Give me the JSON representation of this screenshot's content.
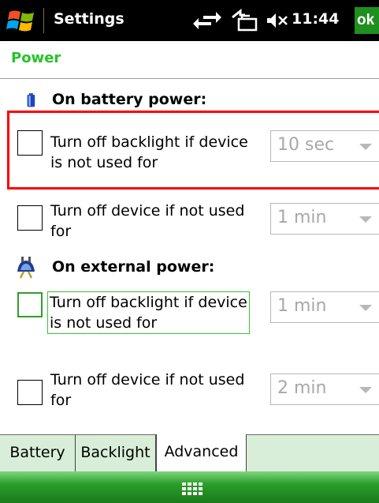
{
  "window": {
    "title": "Settings",
    "clock": "11:44",
    "ok_label": "ok"
  },
  "page": {
    "heading": "Power"
  },
  "battery_group": {
    "label": "On battery power:",
    "backlight": {
      "label_line1": "Turn off backlight if device",
      "label_line2": "is not used for",
      "checked": false,
      "value": "10 sec"
    },
    "device": {
      "label_line1": "Turn off device if not used",
      "label_line2": "for",
      "checked": false,
      "value": "1 min"
    }
  },
  "external_group": {
    "label": "On external power:",
    "backlight": {
      "label_line1": "Turn off backlight if device",
      "label_line2": "is not used for",
      "checked": false,
      "value": "1 min"
    },
    "device": {
      "label_line1": "Turn off device if not used",
      "label_line2": "for",
      "checked": false,
      "value": "2 min"
    }
  },
  "tabs": [
    {
      "label": "Battery"
    },
    {
      "label": "Backlight"
    },
    {
      "label": "Advanced"
    }
  ],
  "active_tab": "Advanced",
  "colors": {
    "accent_green": "#26c426",
    "highlight_red": "#ff0000",
    "title_bar": "#000000"
  },
  "icons": {
    "start": "windows-flag-icon",
    "connectivity": "connectivity-arrows-icon",
    "sync": "sync-icon",
    "volume": "volume-muted-icon",
    "battery": "battery-icon",
    "external_power": "power-plug-icon",
    "keyboard": "keyboard-icon"
  }
}
